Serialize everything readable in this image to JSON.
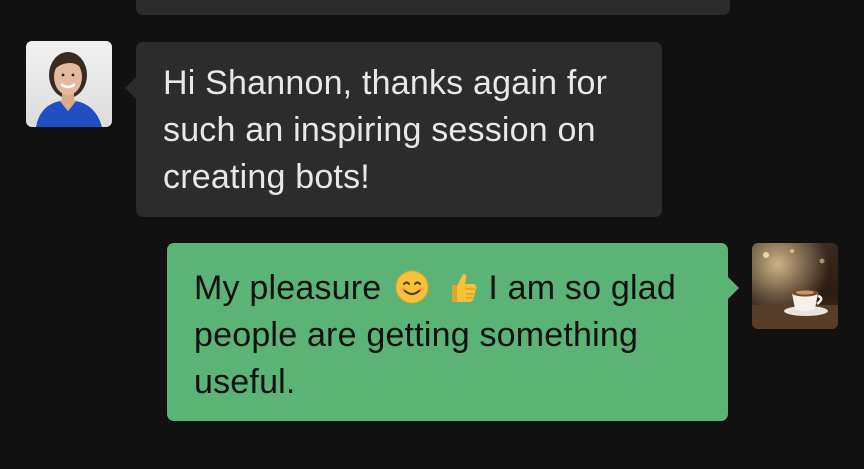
{
  "conversation": {
    "messages": [
      {
        "direction": "incoming",
        "avatar": "woman-avatar",
        "text": "Hi Shannon, thanks again for such an inspiring session on creating bots!"
      },
      {
        "direction": "outgoing",
        "avatar": "coffee-avatar",
        "text_before": "My pleasure",
        "emojis": [
          "smiling-face-icon",
          "thumbs-up-icon"
        ],
        "text_after": "I am so glad people are getting something useful."
      }
    ]
  },
  "colors": {
    "background": "#111111",
    "incoming_bubble": "#2c2c2c",
    "outgoing_bubble": "#5cb376",
    "incoming_text": "#e8e8e8",
    "outgoing_text": "#111111"
  }
}
